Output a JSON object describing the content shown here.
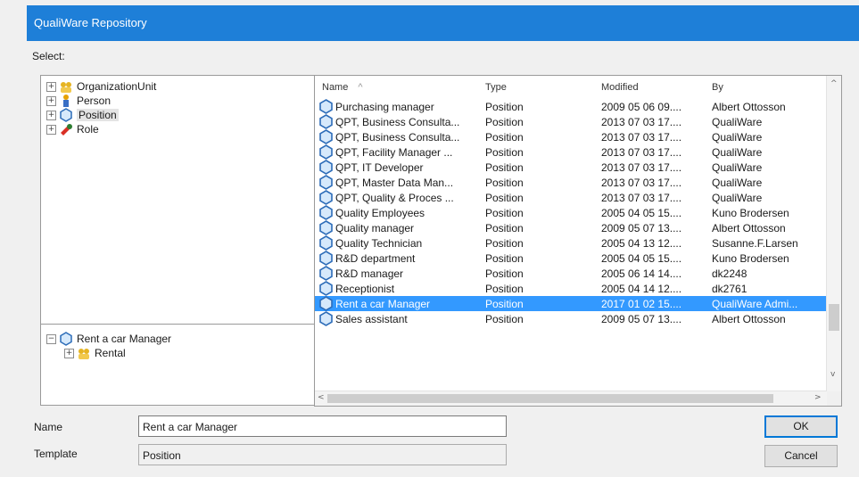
{
  "window": {
    "title": "QualiWare Repository"
  },
  "select_label": "Select:",
  "tree_top": [
    {
      "label": "OrganizationUnit",
      "icon": "organization-unit-icon",
      "expander": "+"
    },
    {
      "label": "Person",
      "icon": "person-icon",
      "expander": "+"
    },
    {
      "label": "Position",
      "icon": "position-icon",
      "expander": "+",
      "selected": true
    },
    {
      "label": "Role",
      "icon": "role-icon",
      "expander": "+"
    }
  ],
  "tree_bottom": [
    {
      "label": "Rent a car Manager",
      "icon": "position-icon",
      "expander": "−"
    },
    {
      "label": "Rental",
      "icon": "organization-unit-icon",
      "expander": "+"
    }
  ],
  "list": {
    "headers": {
      "name": "Name",
      "type": "Type",
      "modified": "Modified",
      "by": "By",
      "sort_indicator": "^"
    },
    "rows": [
      {
        "name": "Purchasing manager",
        "type": "Position",
        "modified": "2009 05 06 09....",
        "by": "Albert Ottosson"
      },
      {
        "name": "QPT, Business Consulta...",
        "type": "Position",
        "modified": "2013 07 03 17....",
        "by": "QualiWare"
      },
      {
        "name": "QPT, Business Consulta...",
        "type": "Position",
        "modified": "2013 07 03 17....",
        "by": "QualiWare"
      },
      {
        "name": "QPT, Facility Manager ...",
        "type": "Position",
        "modified": "2013 07 03 17....",
        "by": "QualiWare"
      },
      {
        "name": "QPT, IT Developer",
        "type": "Position",
        "modified": "2013 07 03 17....",
        "by": "QualiWare"
      },
      {
        "name": "QPT, Master Data Man...",
        "type": "Position",
        "modified": "2013 07 03 17....",
        "by": "QualiWare"
      },
      {
        "name": "QPT, Quality & Proces ...",
        "type": "Position",
        "modified": "2013 07 03 17....",
        "by": "QualiWare"
      },
      {
        "name": "Quality Employees",
        "type": "Position",
        "modified": "2005 04 05 15....",
        "by": "Kuno Brodersen"
      },
      {
        "name": "Quality manager",
        "type": "Position",
        "modified": "2009 05 07 13....",
        "by": "Albert Ottosson"
      },
      {
        "name": "Quality Technician",
        "type": "Position",
        "modified": "2005 04 13 12....",
        "by": "Susanne.F.Larsen"
      },
      {
        "name": "R&D department",
        "type": "Position",
        "modified": "2005 04 05 15....",
        "by": "Kuno Brodersen"
      },
      {
        "name": "R&D manager",
        "type": "Position",
        "modified": "2005 06 14 14....",
        "by": "dk2248"
      },
      {
        "name": "Receptionist",
        "type": "Position",
        "modified": "2005 04 14 12....",
        "by": "dk2761"
      },
      {
        "name": "Rent a car Manager",
        "type": "Position",
        "modified": "2017 01 02 15....",
        "by": "QualiWare Admi...",
        "selected": true
      },
      {
        "name": "Sales assistant",
        "type": "Position",
        "modified": "2009 05 07 13....",
        "by": "Albert Ottosson"
      }
    ]
  },
  "form": {
    "name_label": "Name",
    "name_value": "Rent a car Manager",
    "template_label": "Template",
    "template_value": "Position"
  },
  "buttons": {
    "ok": "OK",
    "cancel": "Cancel"
  },
  "colors": {
    "title_bar": "#1e7fd8",
    "selection": "#3399ff"
  }
}
